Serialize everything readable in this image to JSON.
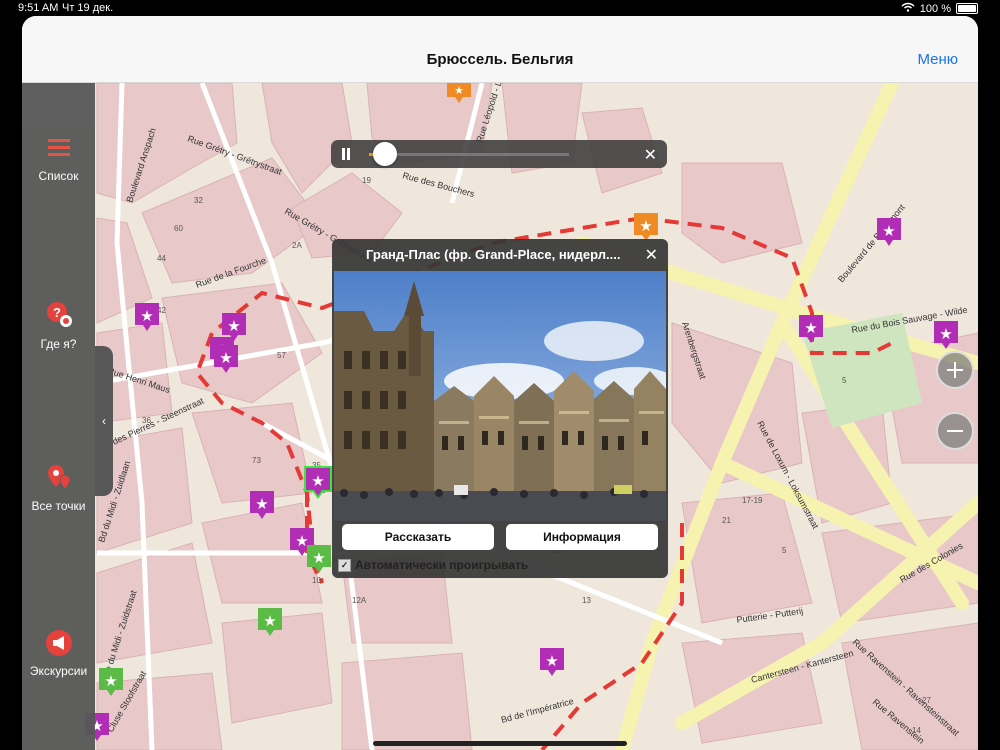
{
  "status_bar": {
    "time": "9:51 AM",
    "date": "Чт 19 дек.",
    "battery": "100 %"
  },
  "nav": {
    "title": "Брюссель. Бельгия",
    "menu_label": "Меню"
  },
  "sidebar": {
    "items": [
      {
        "label": "Список",
        "icon": "list-icon"
      },
      {
        "label": "Где я?",
        "icon": "location-icon"
      },
      {
        "label": "Все точки",
        "icon": "all-points-icon"
      },
      {
        "label": "Экскурсии",
        "icon": "megaphone-icon"
      }
    ],
    "handle_icon": "‹"
  },
  "player": {
    "close_icon": "✕"
  },
  "popup": {
    "title": "Гранд-Плас (фр. Grand-Place, нидерл....",
    "close_icon": "✕",
    "tell_button": "Рассказать",
    "info_button": "Информация",
    "autoplay_label": "Автоматически проигрывать",
    "autoplay_checked": "✓"
  },
  "map_labels": {
    "streets": [
      "Rue Grétry - Grétrystraat",
      "Rue Grétry - Grétrystraat",
      "Rue Léopold - Leopoldstraat",
      "Boulevard Anspach",
      "Rue Henri Maus",
      "Rue des Pierres - Steenstraat",
      "Bd du Midi - Zuidlaan",
      "Rue de Loxum - Loksumstraat",
      "Boulevard de Berlaimont",
      "Rue du Bois Sauvage - Wilde",
      "Rue des Colonies",
      "Rue Ravenstein - Ravensteinstraat",
      "Putterie - Putterij",
      "Cantersteen - Kantersteen",
      "Arenbergstraat",
      "Rue de la Fourche",
      "Rue des Bouchers",
      "Rue Ravenstein",
      "Cluse Stoofstraat",
      "Rue du Midi - Zuidstraat",
      "Bd de l'Impératrice"
    ],
    "buildings": [
      "16",
      "44",
      "10",
      "12A",
      "32",
      "42",
      "17-19",
      "5",
      "36",
      "60",
      "35",
      "45",
      "73",
      "19",
      "2A",
      "57",
      "21",
      "5",
      "26",
      "13",
      "27",
      "14"
    ]
  },
  "colors": {
    "map_bg": "#efe7dc",
    "block_pink": "#e8c8c9",
    "road_yellow": "#f6f2b0",
    "route_red": "#e53935",
    "pin_purple": "#b22db5",
    "pin_green": "#5cba47",
    "pin_orange": "#f08a24"
  }
}
